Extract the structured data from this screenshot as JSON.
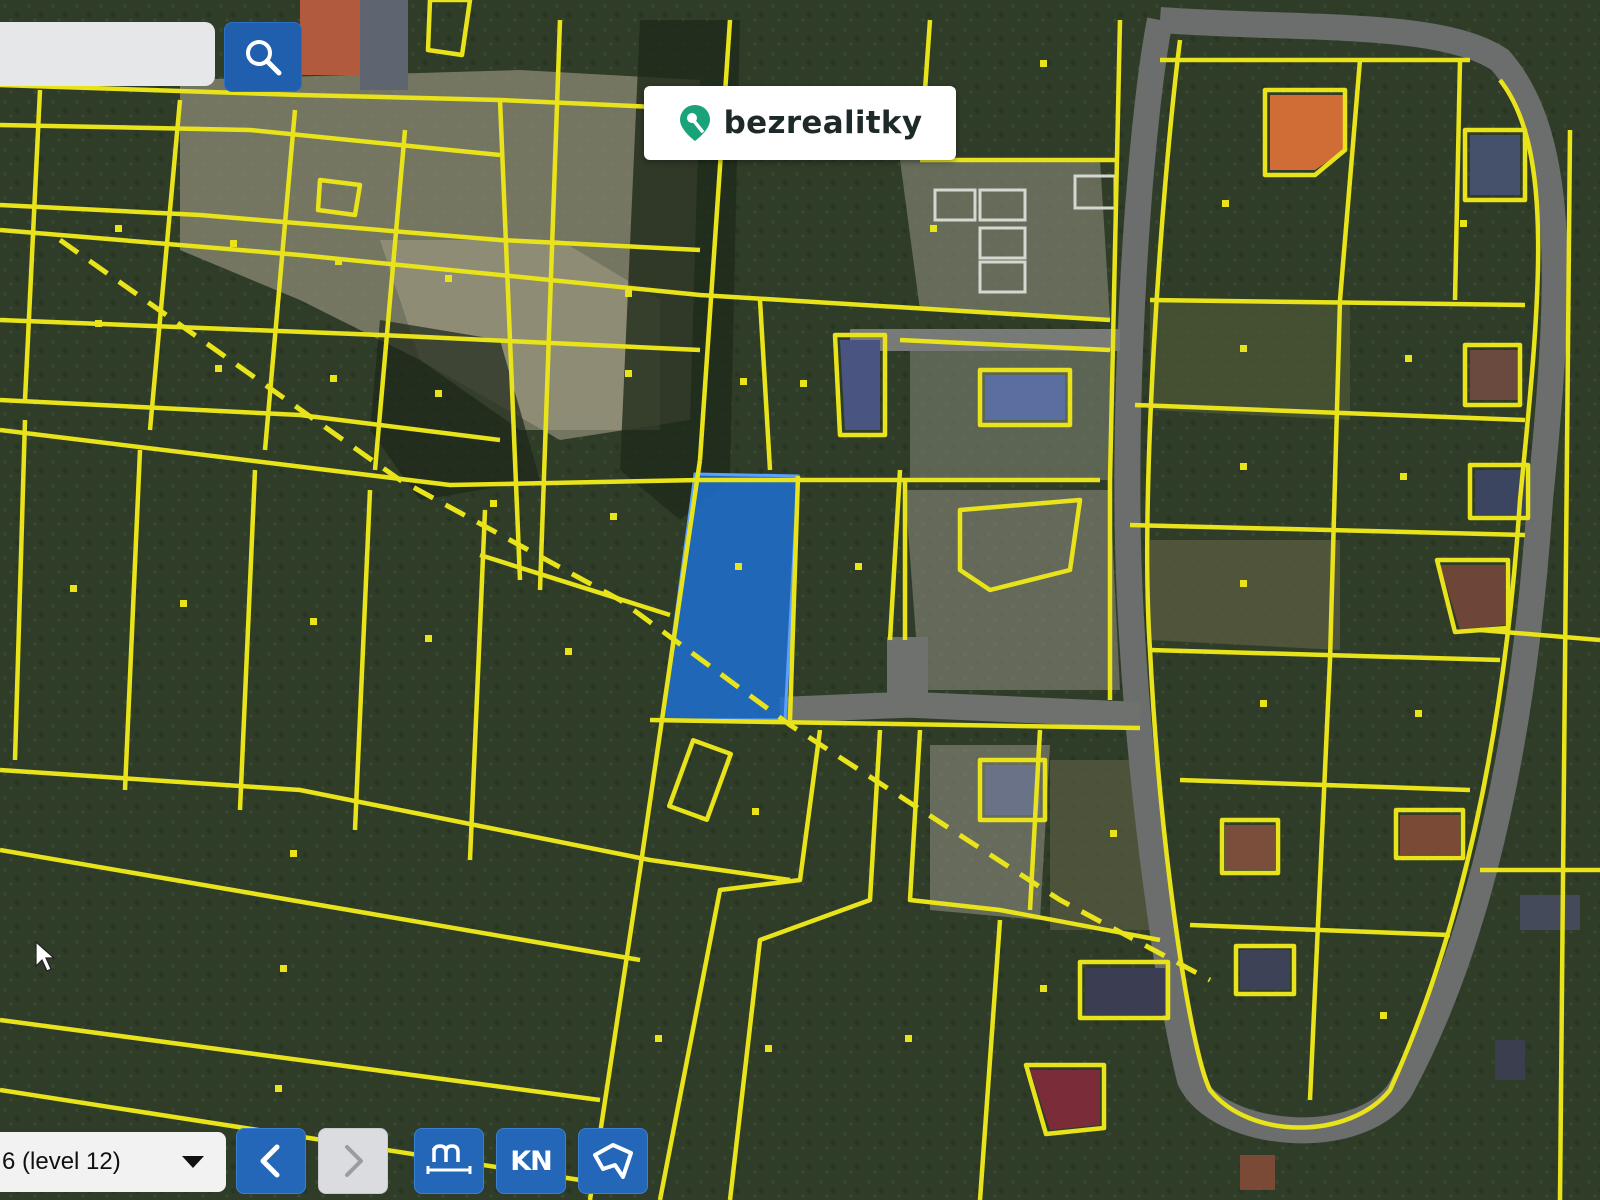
{
  "brand": {
    "name": "bezrealitky",
    "pin_color": "#1aa37a"
  },
  "search": {
    "value": "",
    "icon": "magnifier-icon"
  },
  "toolbar": {
    "level_label": "6 (level 12)",
    "prev_icon": "chevron-left-icon",
    "next_icon": "chevron-right-icon",
    "measure_icon": "ruler-measure-icon",
    "cadastre_label": "KN",
    "parcel_icon": "parcel-shape-icon"
  },
  "map": {
    "highlight_color": "#1e6fd0",
    "boundary_color": "#e8e31a"
  }
}
